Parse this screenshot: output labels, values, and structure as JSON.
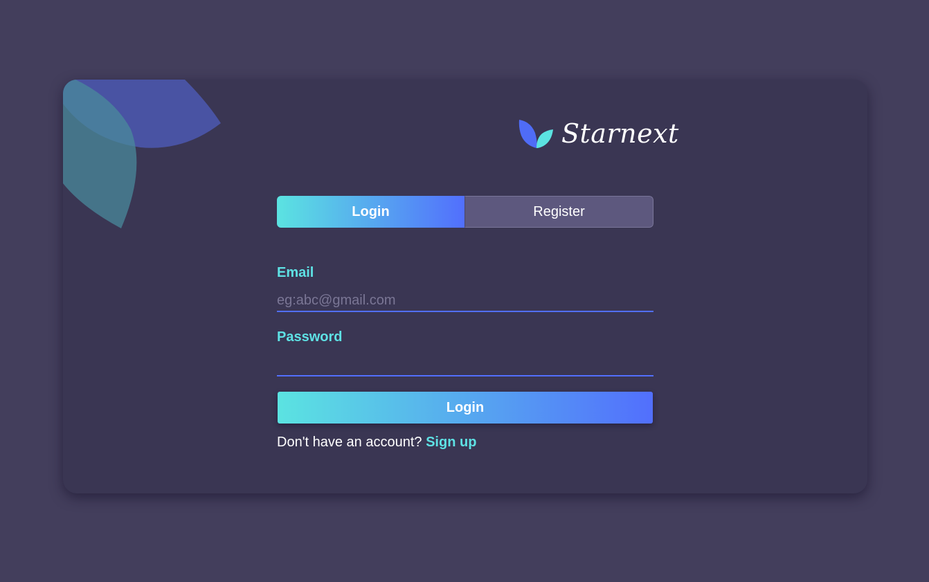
{
  "brand": {
    "name": "Starnext",
    "logo_icon": "leaves-icon"
  },
  "tabs": [
    {
      "label": "Login",
      "active": true
    },
    {
      "label": "Register",
      "active": false
    }
  ],
  "form": {
    "email_label": "Email",
    "email_placeholder": "eg:abc@gmail.com",
    "email_value": "",
    "password_label": "Password",
    "password_value": "",
    "submit_label": "Login"
  },
  "footer": {
    "prompt": "Don't have an account?",
    "link_label": "Sign up"
  },
  "colors": {
    "page_bg": "#433e5c",
    "card_bg": "#3a3653",
    "accent_cyan": "#5ee1e4",
    "accent_blue": "#526ffd",
    "tab_inactive": "#5d587e"
  }
}
